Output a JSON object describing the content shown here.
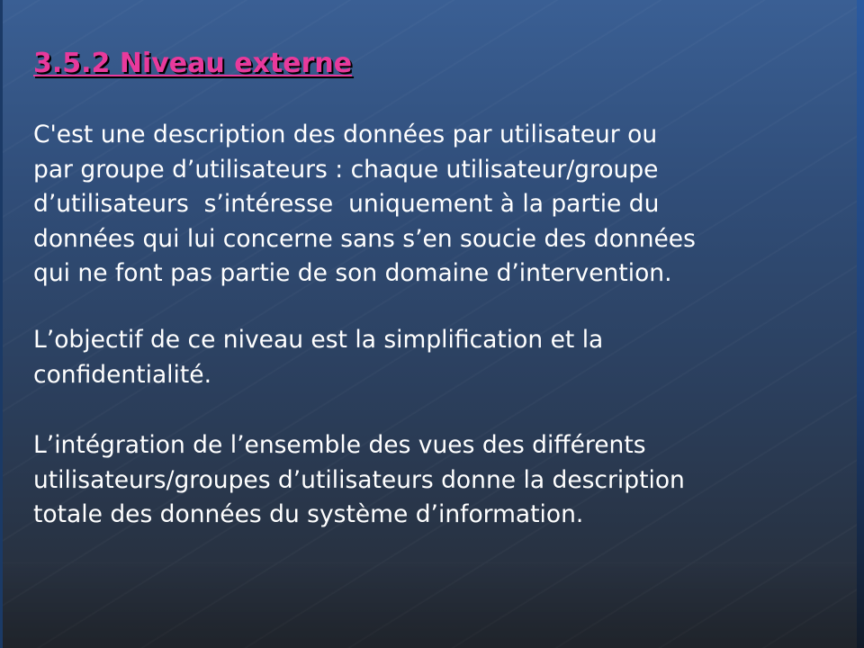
{
  "slide": {
    "heading": "3.5.2 Niveau externe",
    "paragraphs": [
      {
        "lines": [
          "C'est une description des données par utilisateur ou",
          "par groupe d’utilisateurs : chaque utilisateur/groupe",
          "d’utilisateurs  s’intéresse  uniquement à la partie du",
          "données qui lui concerne sans s’en soucie des données",
          "qui ne font pas partie de son domaine d’intervention."
        ]
      },
      {
        "lines": [
          "L’objectif de ce niveau est la simplification et la",
          "confidentialité."
        ]
      },
      {
        "lines": [
          "L’intégration de l’ensemble des vues des différents",
          "utilisateurs/groupes d’utilisateurs donne la description",
          "totale des données du système d’information."
        ]
      }
    ]
  },
  "colors": {
    "heading": "#e83a9c",
    "body_text": "#ffffff",
    "background_top": "#3a5f94",
    "background_bottom": "#262b33"
  }
}
